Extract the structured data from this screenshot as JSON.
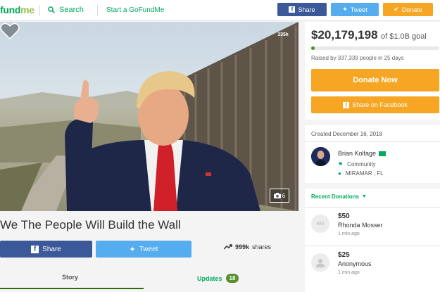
{
  "header": {
    "logo_main": "fund",
    "logo_accent": "me",
    "search_label": "Search",
    "start_label": "Start a GoFundMe",
    "share_label": "Share",
    "tweet_label": "Tweet",
    "donate_label": "Donate"
  },
  "hero": {
    "heart_count": "335k",
    "photo_count": "6"
  },
  "campaign": {
    "title": "We The People Will Build the Wall",
    "share_label": "Share",
    "tweet_label": "Tweet",
    "shares_count": "999k",
    "shares_suffix": "shares"
  },
  "tabs": {
    "story": "Story",
    "updates": "Updates",
    "updates_count": "18"
  },
  "sidebar": {
    "amount": "$20,179,198",
    "goal": "of $1.0B goal",
    "progress_fraction": 0.02,
    "raised_by": "Raised by 337,339 people in 25 days",
    "donate_now": "Donate Now",
    "share_facebook": "Share on Facebook",
    "created": "Created December 16, 2018",
    "organizer": {
      "name": "Brian Kolfage",
      "category": "Community",
      "location": "MIRAMAR , FL"
    },
    "recent_label": "Recent Donations",
    "donations": [
      {
        "avatar": "BM",
        "amount": "$50",
        "name": "Rhonda Mosser",
        "time": "1 min ago"
      },
      {
        "avatar": "",
        "amount": "$25",
        "name": "Anonymous",
        "time": "1 min ago"
      }
    ]
  },
  "colors": {
    "brand_green": "#02a95c",
    "facebook": "#3b5998",
    "twitter": "#55acee",
    "donate_orange": "#f6a623"
  }
}
